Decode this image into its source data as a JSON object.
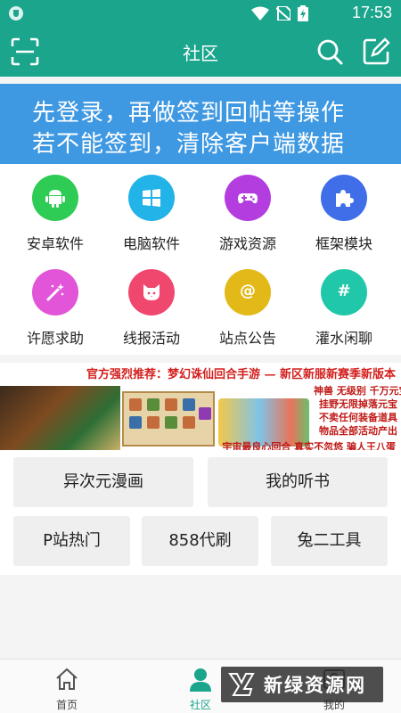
{
  "status_bar": {
    "time": "17:53"
  },
  "app_bar": {
    "title": "社区"
  },
  "notice": {
    "line1": "先登录，再做签到回帖等操作",
    "line2": "若不能签到，清除客户端数据"
  },
  "categories": [
    {
      "label": "安卓软件",
      "icon": "android-icon",
      "color": "#2ecc55"
    },
    {
      "label": "电脑软件",
      "icon": "windows-icon",
      "color": "#22b3e8"
    },
    {
      "label": "游戏资源",
      "icon": "gamepad-icon",
      "color": "#b43de0"
    },
    {
      "label": "框架模块",
      "icon": "puzzle-icon",
      "color": "#3f6ee8"
    },
    {
      "label": "许愿求助",
      "icon": "magic-wand-icon",
      "color": "#e255d8"
    },
    {
      "label": "线报活动",
      "icon": "cat-icon",
      "color": "#f0476e"
    },
    {
      "label": "站点公告",
      "icon": "at-icon",
      "color": "#e2b919",
      "glyph": "@"
    },
    {
      "label": "灌水闲聊",
      "icon": "hash-icon",
      "color": "#20c7a8",
      "glyph": "#"
    }
  ],
  "banner": {
    "headline": "官方强烈推荐：梦幻诛仙回合手游 — 新区新服新赛季新版本",
    "features": [
      "神兽 无级别 千万元宝 建号即领",
      "挂野无限掉落元宝",
      "不卖任何装备道具",
      "物品全部活动产出"
    ],
    "bottom": "宇宙最良心回合 真实不忽悠 骗人王八蛋"
  },
  "links": [
    "异次元漫画",
    "我的听书",
    "P站热门",
    "858代刷",
    "兔二工具"
  ],
  "tabs": [
    {
      "label": "首页",
      "icon": "home-icon"
    },
    {
      "label": "社区",
      "icon": "user-icon"
    },
    {
      "label": "我的",
      "icon": "profile-icon"
    }
  ],
  "watermark": {
    "text": "新绿资源网"
  },
  "colors": {
    "primary": "#1aa58c",
    "notice_bg": "#3e98e2"
  }
}
